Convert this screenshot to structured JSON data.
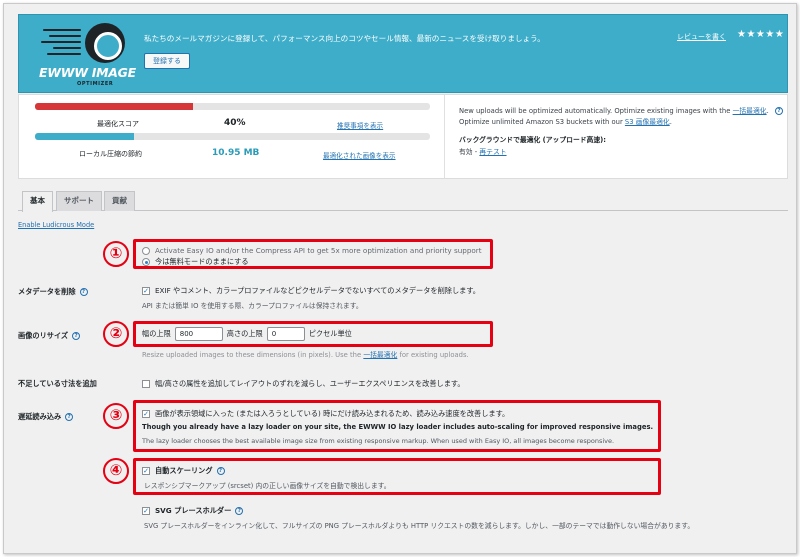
{
  "banner": {
    "text": "私たちのメールマガジンに登録して、パフォーマンス向上のコツやセール情報、最新のニュースを受け取りましょう。",
    "register_label": "登録する",
    "review_label": "レビューを書く",
    "stars": "★★★★★",
    "logo_name": "EWWW IMAGE",
    "logo_sub": "OPTIMIZER"
  },
  "stats": {
    "score": {
      "label": "最適化スコア",
      "value": "40%",
      "link": "推奨事項を表示",
      "progress": 0.4,
      "color": "#d63638"
    },
    "savings": {
      "label": "ローカル圧縮の節約",
      "value": "10.95 MB",
      "link": "最適化された画像を表示",
      "progress": 0.25,
      "color": "#3eadc9"
    },
    "info_line1_pre": "New uploads will be optimized automatically. Optimize existing images with the ",
    "info_line1_link": "一括最適化",
    "info_line1_post": ".",
    "info_line2_pre": "Optimize unlimited Amazon S3 buckets with our ",
    "info_line2_link": "S3 画像最適化",
    "info_line2_post": ".",
    "bg_title": "バックグラウンドで最適化 (アップロード高速):",
    "bg_status": "有効",
    "bg_sep": " - ",
    "bg_test_link": "再テスト"
  },
  "tabs": [
    {
      "label": "基本",
      "active": true
    },
    {
      "label": "サポート",
      "active": false
    },
    {
      "label": "貢献",
      "active": false
    }
  ],
  "ludicrous_link": "Enable Ludicrous Mode",
  "settings": {
    "mode": {
      "option1": "Activate Easy IO and/or the Compress API to get 5x more optimization and priority support",
      "option2": "今は無料モードのままにする"
    },
    "metadata": {
      "label": "メタデータを削除",
      "option": "EXIF やコメント、カラープロファイルなどピクセルデータでないすべてのメタデータを削除します。",
      "desc": "API または簡単 IO を使用する際、カラープロファイルは保持されます。"
    },
    "resize": {
      "label": "画像のリサイズ",
      "width_label": "幅の上限",
      "width_value": "800",
      "height_label": "高さの上限",
      "height_value": "0",
      "unit": "ピクセル単位",
      "desc_pre": "Resize uploaded images to these dimensions (in pixels). Use the ",
      "desc_link": "一括最適化",
      "desc_post": " for existing uploads."
    },
    "dimensions": {
      "label": "不足している寸法を追加",
      "option": "幅/高さの属性を追加してレイアウトのずれを減らし、ユーザーエクスペリエンスを改善します。"
    },
    "lazy": {
      "label": "遅延読み込み",
      "option": "画像が表示領域に入った (または入ろうとしている) 時にだけ読み込まれるため、読み込み速度を改善します。",
      "note_bold": "Though you already have a lazy loader on your site, the EWWW IO lazy loader includes auto-scaling for improved responsive images.",
      "note": "The lazy loader chooses the best available image size from existing responsive markup. When used with Easy IO, all images become responsive.",
      "autoscale_label": "自動スケーリング",
      "autoscale_desc": "レスポンシブマークアップ (srcset) 内の正しい画像サイズを自動で検出します。",
      "svg_label": "SVG プレースホルダー",
      "svg_desc": "SVG プレースホルダーをインライン化して、フルサイズの PNG プレースホルダよりも HTTP リクエストの数を減らします。しかし、一部のテーマでは動作しない場合があります。"
    }
  },
  "annotations": [
    "①",
    "②",
    "③",
    "④"
  ],
  "colors": {
    "banner": "#3eadc9",
    "accent": "#2271b1",
    "annotation": "#e50012"
  }
}
